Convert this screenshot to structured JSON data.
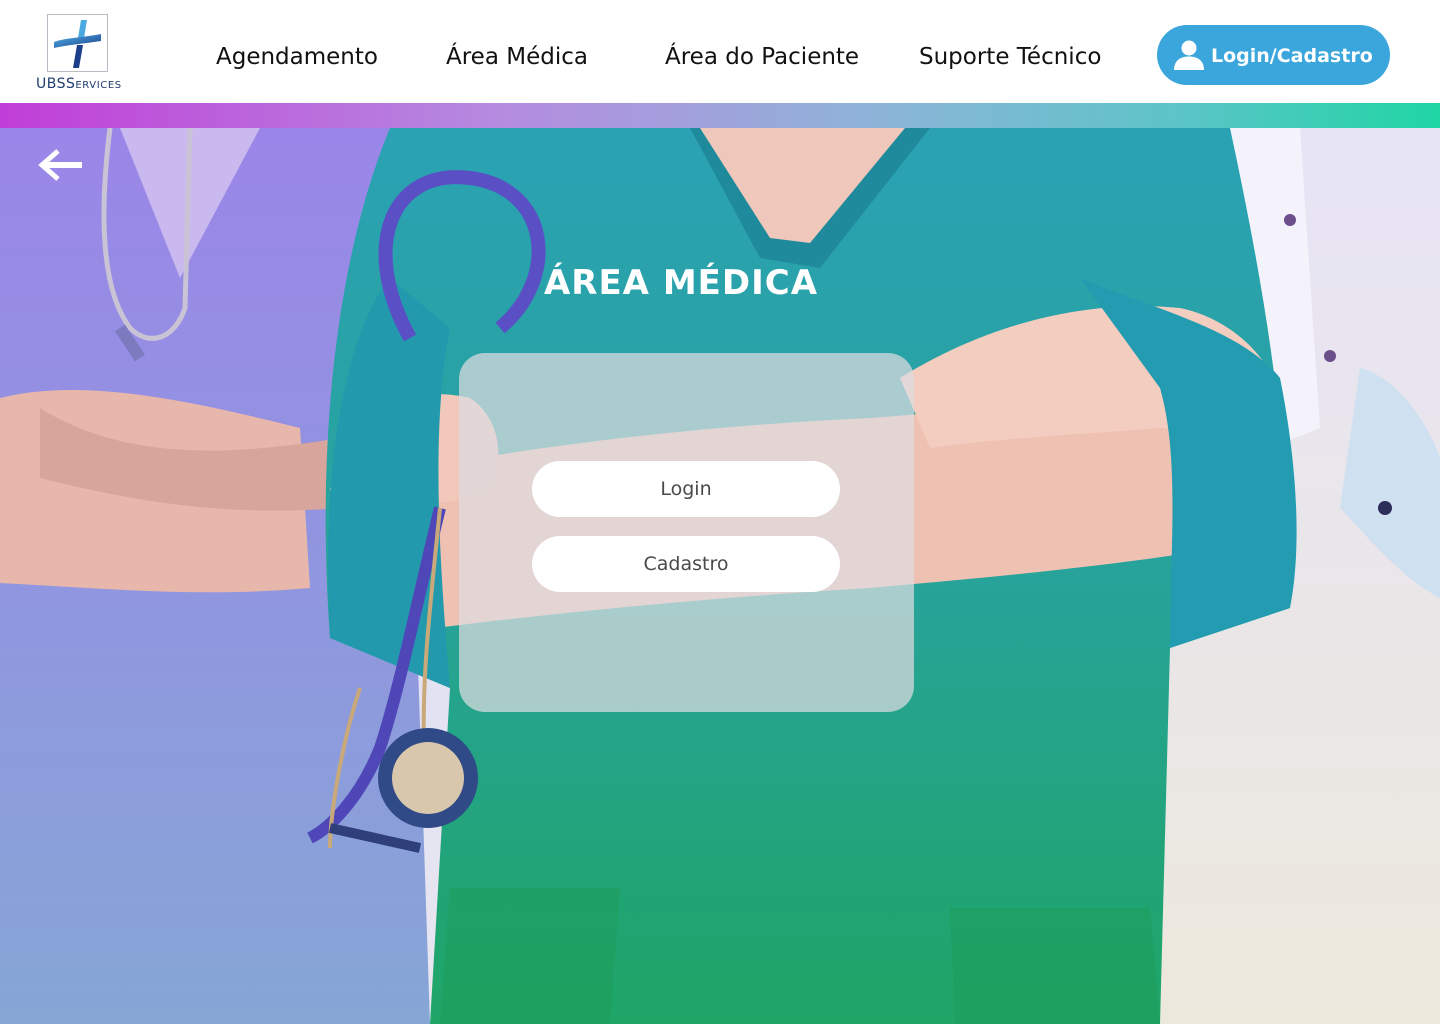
{
  "header": {
    "logo": {
      "brand_main": "UBS",
      "brand_small": "ERVICES",
      "brand_small_initial": "S",
      "icon": "medical-cross-icon"
    },
    "nav": [
      {
        "label": "Agendamento"
      },
      {
        "label": "Área Médica"
      },
      {
        "label": "Área do Paciente"
      },
      {
        "label": "Suporte Técnico"
      }
    ],
    "login_button": {
      "label": "Login/Cadastro",
      "icon": "user-icon"
    }
  },
  "main": {
    "back_icon": "back-arrow-icon",
    "title": "ÁREA MÉDICA",
    "panel": {
      "login_label": "Login",
      "cadastro_label": "Cadastro"
    }
  },
  "colors": {
    "cta_blue": "#3aa6dc",
    "gradient_start": "#c13ed8",
    "gradient_end": "#1fd6a4",
    "scrub_teal": "#2aa3a8",
    "scrub_purple": "#9b8be4"
  }
}
